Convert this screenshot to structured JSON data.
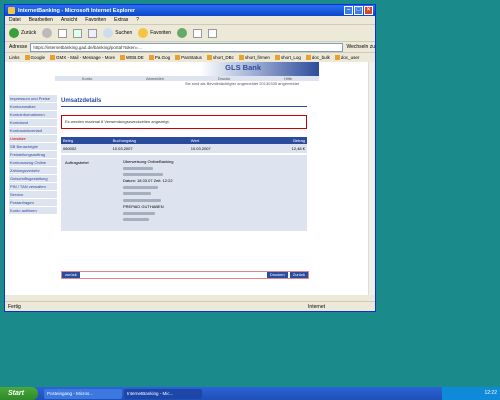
{
  "window": {
    "title": "InternetBanking - Microsoft Internet Explorer"
  },
  "menu": [
    "Datei",
    "Bearbeiten",
    "Ansicht",
    "Favoriten",
    "Extras",
    "?"
  ],
  "toolbar": {
    "back": "Zurück",
    "search": "Suchen",
    "favorites": "Favoriten"
  },
  "address": {
    "label": "Adresse",
    "value": "https://internetbanking.gad.de/banking/portal?token=...",
    "go": "Wechseln zu"
  },
  "links": {
    "label": "Links",
    "items": [
      "Google",
      "GMX - Mail - Message - More",
      "WEB.DE",
      "Pa.Gog",
      "PanStatus",
      "short_DBc",
      "short_firmen",
      "short_Log",
      "doc_bulk",
      "doc_user"
    ]
  },
  "bank": {
    "logo": "GLS Bank",
    "nav": [
      "Konto",
      "Abmelden",
      "Drucke",
      "Hilfe"
    ],
    "session": "Sie sind als Bevollmächtigter angemeldet 20130330 angemeldet"
  },
  "sidebar": {
    "items": [
      "Impressum und Preise",
      "Kontoumsätze",
      "Kontoinformationen",
      "Kontoland",
      "Kontosaldoverlauf",
      "Umsätze",
      "SB Benachrigte",
      "Freistellungsauftrag",
      "Kontoauszug Online",
      "Zahlungsverkehr",
      "Gutschriftsgestaltung",
      "PIN / TAN verwalten",
      "Service",
      "Postanfragen",
      "Konto auflösen"
    ],
    "active": "Umsätze"
  },
  "main": {
    "title": "Umsatzdetails",
    "alert": "Es werden maximal 8 Verwendungszweckzeilen angezeigt.",
    "table": {
      "headers": [
        "Beleg",
        "Buchungstag",
        "Wert",
        "Betrag"
      ],
      "row": [
        "060002",
        "10.03.2007",
        "10.03.2007",
        "12,48 €"
      ]
    },
    "detail": {
      "label": "Auftragsbetel",
      "lines": [
        "Überweisung OnlineBanking",
        "",
        "",
        "Datum: 18.03.07 Zeit: 12:22",
        "",
        "",
        "",
        "PREPAID GUTHABEN",
        "",
        ""
      ]
    },
    "buttons": {
      "left": "zurück",
      "mid": "Drucken",
      "right": "Zurück"
    }
  },
  "status": {
    "left": "Fertig",
    "right": "Internet"
  },
  "taskbar": {
    "start": "Start",
    "tasks": [
      "Posteingang - Micros...",
      "InternetBanking - Mic..."
    ],
    "clock": "12:22"
  }
}
